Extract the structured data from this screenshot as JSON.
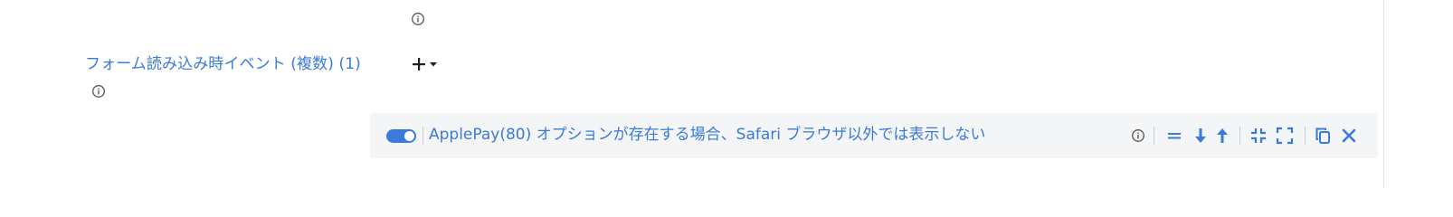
{
  "field": {
    "label": "フォーム読み込み時イベント (複数) (1)"
  },
  "event": {
    "enabled": true,
    "title": "ApplePay(80) オプションが存在する場合、Safari ブラウザ以外では表示しない"
  },
  "icons": {
    "info": "info-icon",
    "add": "plus-icon",
    "dropdown": "caret-down-icon",
    "drag": "drag-handle-icon",
    "move_down": "arrow-down-icon",
    "move_up": "arrow-up-icon",
    "collapse": "collapse-icon",
    "expand": "expand-icon",
    "duplicate": "copy-icon",
    "remove": "close-icon"
  },
  "colors": {
    "link_blue": "#3a7ad9",
    "row_background": "#f4f5f7",
    "icon_dark": "#333333"
  }
}
